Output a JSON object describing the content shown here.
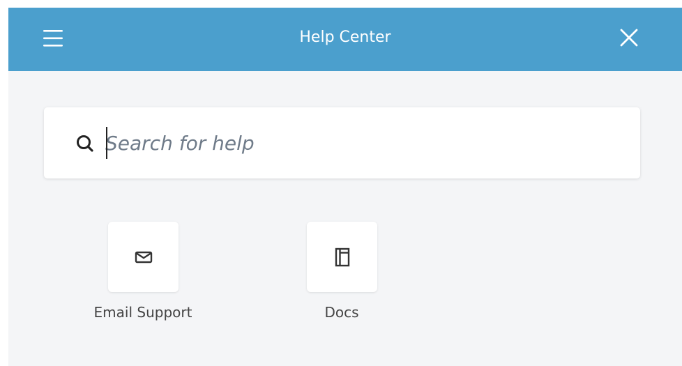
{
  "header": {
    "title": "Help Center",
    "background_color": "#4b9fcd",
    "menu_icon": "hamburger-menu-icon",
    "close_icon": "close-icon"
  },
  "search": {
    "placeholder": "Search for help",
    "value": "",
    "icon": "search-icon"
  },
  "options": [
    {
      "label": "Email Support",
      "icon": "envelope-icon"
    },
    {
      "label": "Docs",
      "icon": "document-icon"
    }
  ]
}
